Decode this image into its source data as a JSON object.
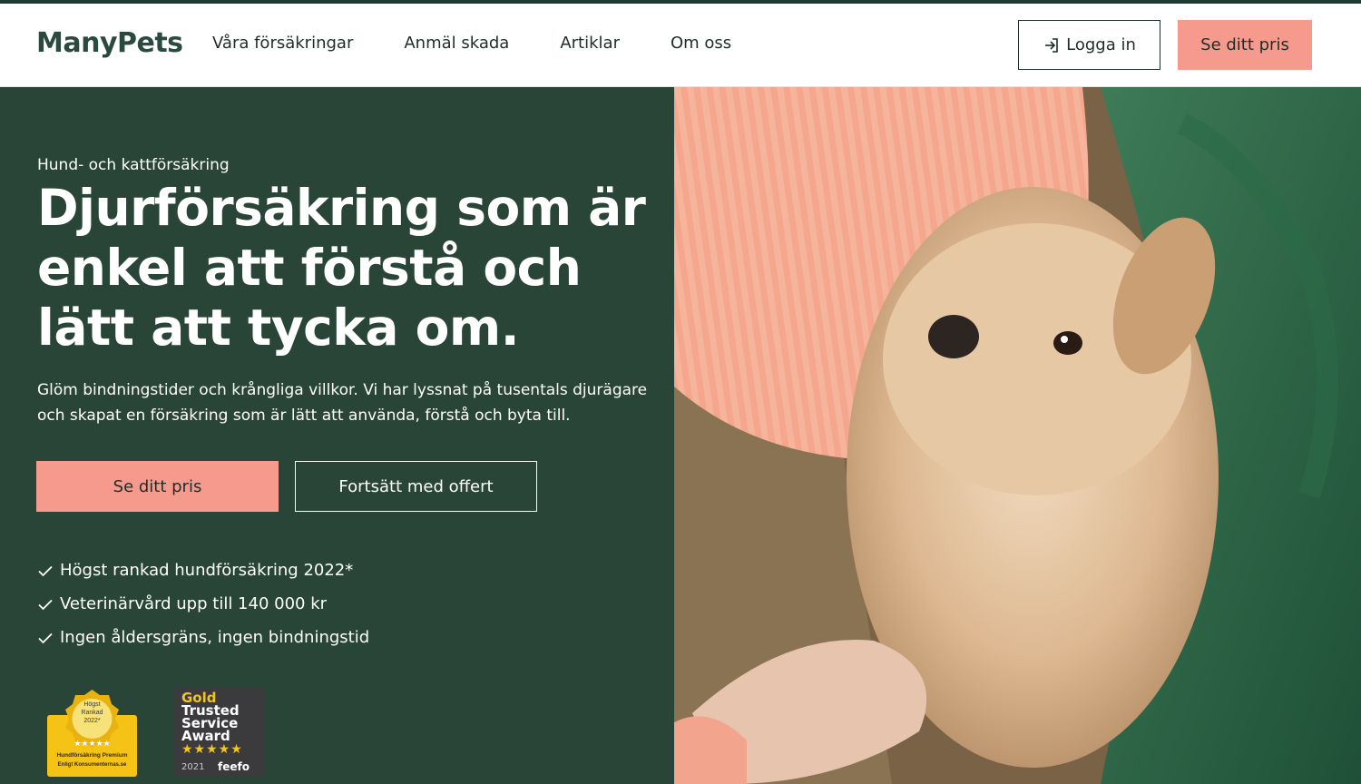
{
  "brand": {
    "logo_text": "ManyPets",
    "logo_color": "#2b4a3f"
  },
  "colors": {
    "primary_dark": "#284537",
    "accent_salmon": "#f79a8e",
    "text_dark": "#1f2d28"
  },
  "nav": {
    "items": [
      {
        "label": "Våra försäkringar"
      },
      {
        "label": "Anmäl skada"
      },
      {
        "label": "Artiklar"
      },
      {
        "label": "Om oss"
      }
    ]
  },
  "header_actions": {
    "login_label": "Logga in",
    "login_icon": "login-arrow-icon",
    "price_label": "Se ditt pris"
  },
  "hero": {
    "eyebrow": "Hund- och kattförsäkring",
    "title": "Djurförsäkring som är enkel att förstå och lätt att tycka om.",
    "lead": "Glöm bindningstider och krångliga villkor. Vi har lyssnat på tusentals djurägare och skapat en försäkring som är lätt att använda, förstå och byta till.",
    "cta_primary": "Se ditt pris",
    "cta_secondary": "Fortsätt med offert",
    "benefits": [
      "Högst rankad hundförsäkring 2022*",
      "Veterinärvård upp till 140 000 kr",
      "Ingen åldersgräns, ingen bindningstid"
    ]
  },
  "badges": {
    "konsumenterna": {
      "top_line1": "Högst",
      "top_line2": "Rankad",
      "top_line3": "2022*",
      "stars": "★★★★★",
      "bottom_line1": "Hundförsäkring Premium",
      "bottom_line2": "Enligt Konsumenternas.se"
    },
    "feefo": {
      "line1": "Gold",
      "line2": "Trusted",
      "line3": "Service",
      "line4": "Award",
      "stars": "★★★★★",
      "year": "2021",
      "brand": "feefo"
    }
  },
  "hero_image": {
    "subject": "dog-photo"
  }
}
